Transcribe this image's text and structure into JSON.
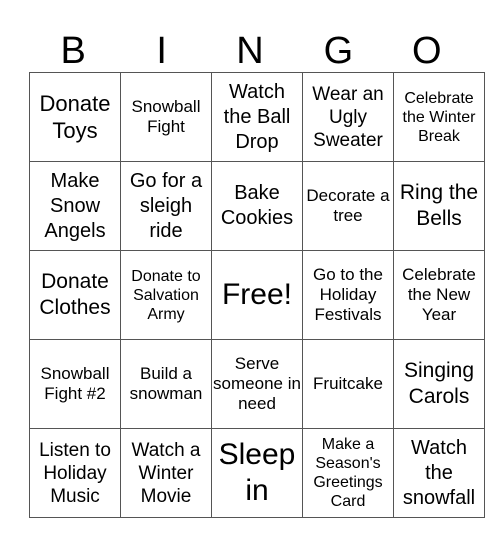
{
  "header": {
    "letters": [
      "B",
      "I",
      "N",
      "G",
      "O"
    ]
  },
  "board": {
    "rows": [
      [
        "Donate Toys",
        "Snowball Fight",
        "Watch the Ball Drop",
        "Wear an Ugly Sweater",
        "Celebrate the Winter Break"
      ],
      [
        "Make Snow Angels",
        "Go for a sleigh ride",
        "Bake Cookies",
        "Decorate a tree",
        "Ring the Bells"
      ],
      [
        "Donate Clothes",
        "Donate to Salvation Army",
        "Free!",
        "Go to the Holiday Festivals",
        "Celebrate the New Year"
      ],
      [
        "Snowball Fight #2",
        "Build a snowman",
        "Serve someone in need",
        "Fruitcake",
        "Singing Carols"
      ],
      [
        "Listen to Holiday Music",
        "Watch a Winter Movie",
        "Sleep in",
        "Make a Season's Greetings Card",
        "Watch the snowfall"
      ]
    ]
  }
}
